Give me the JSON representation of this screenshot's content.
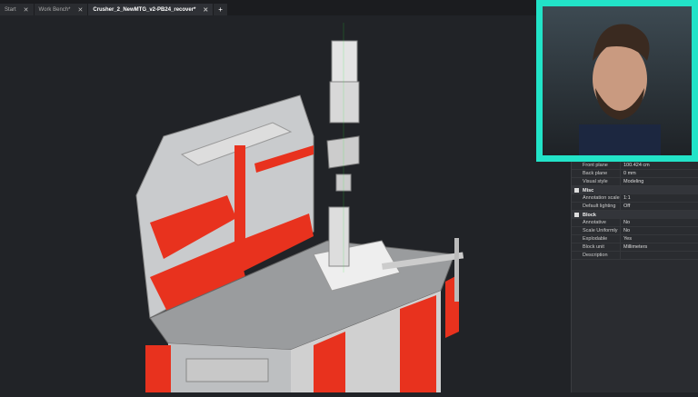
{
  "tabs": [
    {
      "label": "Start"
    },
    {
      "label": "Work Bench*"
    },
    {
      "label": "Crusher_2_NewMTG_v2-PB24_recover*"
    }
  ],
  "new_tab": "+",
  "close_glyph": "✕",
  "properties": {
    "rows_top": [
      {
        "k": "Front plane",
        "v": "100.424 cm"
      },
      {
        "k": "Back plane",
        "v": "0 mm"
      },
      {
        "k": "Visual style",
        "v": "Modeling"
      }
    ],
    "misc": {
      "title": "Misc",
      "rows": [
        {
          "k": "Annotation scale",
          "v": "1:1"
        },
        {
          "k": "Default lighting",
          "v": "Off"
        }
      ]
    },
    "block": {
      "title": "Block",
      "rows": [
        {
          "k": "Annotative",
          "v": "No"
        },
        {
          "k": "Scale Uniformly",
          "v": "No"
        },
        {
          "k": "Explodable",
          "v": "Yes"
        },
        {
          "k": "Block unit",
          "v": "Millimeters"
        },
        {
          "k": "Description",
          "v": ""
        }
      ]
    }
  },
  "colors": {
    "accent": "#22e3c8",
    "red": "#e8321e"
  }
}
